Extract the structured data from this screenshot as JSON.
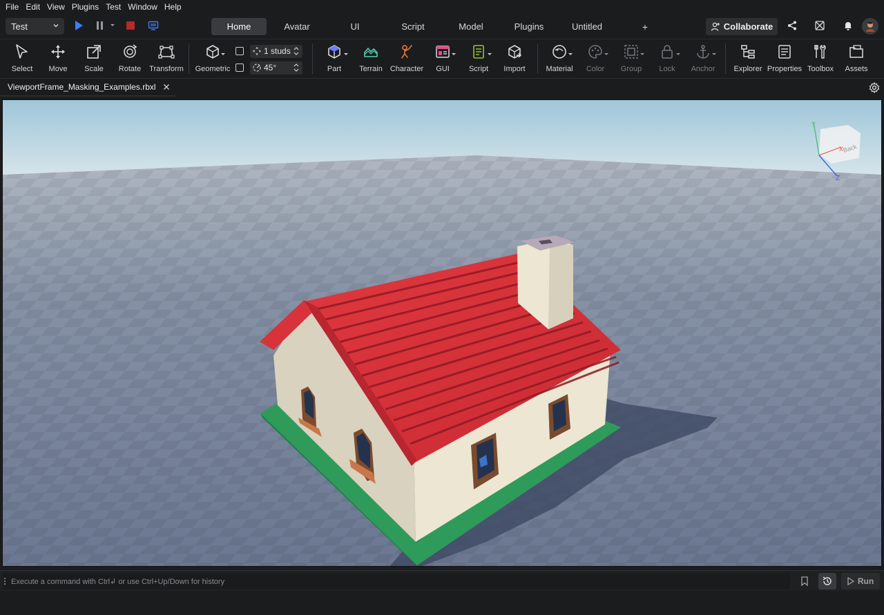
{
  "menu": [
    "File",
    "Edit",
    "View",
    "Plugins",
    "Test",
    "Window",
    "Help"
  ],
  "mode_select": "Test",
  "tabs": [
    {
      "label": "Home",
      "active": true
    },
    {
      "label": "Avatar"
    },
    {
      "label": "UI"
    },
    {
      "label": "Script"
    },
    {
      "label": "Model"
    },
    {
      "label": "Plugins"
    },
    {
      "label": "Untitled"
    },
    {
      "label": "+"
    }
  ],
  "collaborate_label": "Collaborate",
  "ribbon": {
    "select": "Select",
    "move": "Move",
    "scale": "Scale",
    "rotate": "Rotate",
    "transform": "Transform",
    "geometric": "Geometric",
    "move_snap": "1 studs",
    "rotate_snap": "45°",
    "part": "Part",
    "terrain": "Terrain",
    "character": "Character",
    "gui": "GUI",
    "script": "Script",
    "import": "Import",
    "material": "Material",
    "color": "Color",
    "group": "Group",
    "lock": "Lock",
    "anchor": "Anchor",
    "explorer": "Explorer",
    "properties": "Properties",
    "toolbox": "Toolbox",
    "assets": "Assets"
  },
  "file_tab": "ViewportFrame_Masking_Examples.rbxl",
  "view_cube": {
    "face": "Back",
    "axis_y": "Y",
    "axis_z": "Z",
    "axis_x": "X"
  },
  "command_bar": {
    "placeholder": "Execute a command with Ctrl↲ or use Ctrl+Up/Down for history",
    "run_label": "Run"
  },
  "colors": {
    "accent_blue": "#3d7cff",
    "stop_red": "#b52a2a",
    "roof_red": "#d8323a",
    "wall_cream": "#ece6d2",
    "base_green": "#2e9b5a",
    "character_orange": "#e8772e",
    "gui_pink": "#e14b8a",
    "script_green": "#8ec33a",
    "terrain_teal": "#4fd1b5"
  }
}
